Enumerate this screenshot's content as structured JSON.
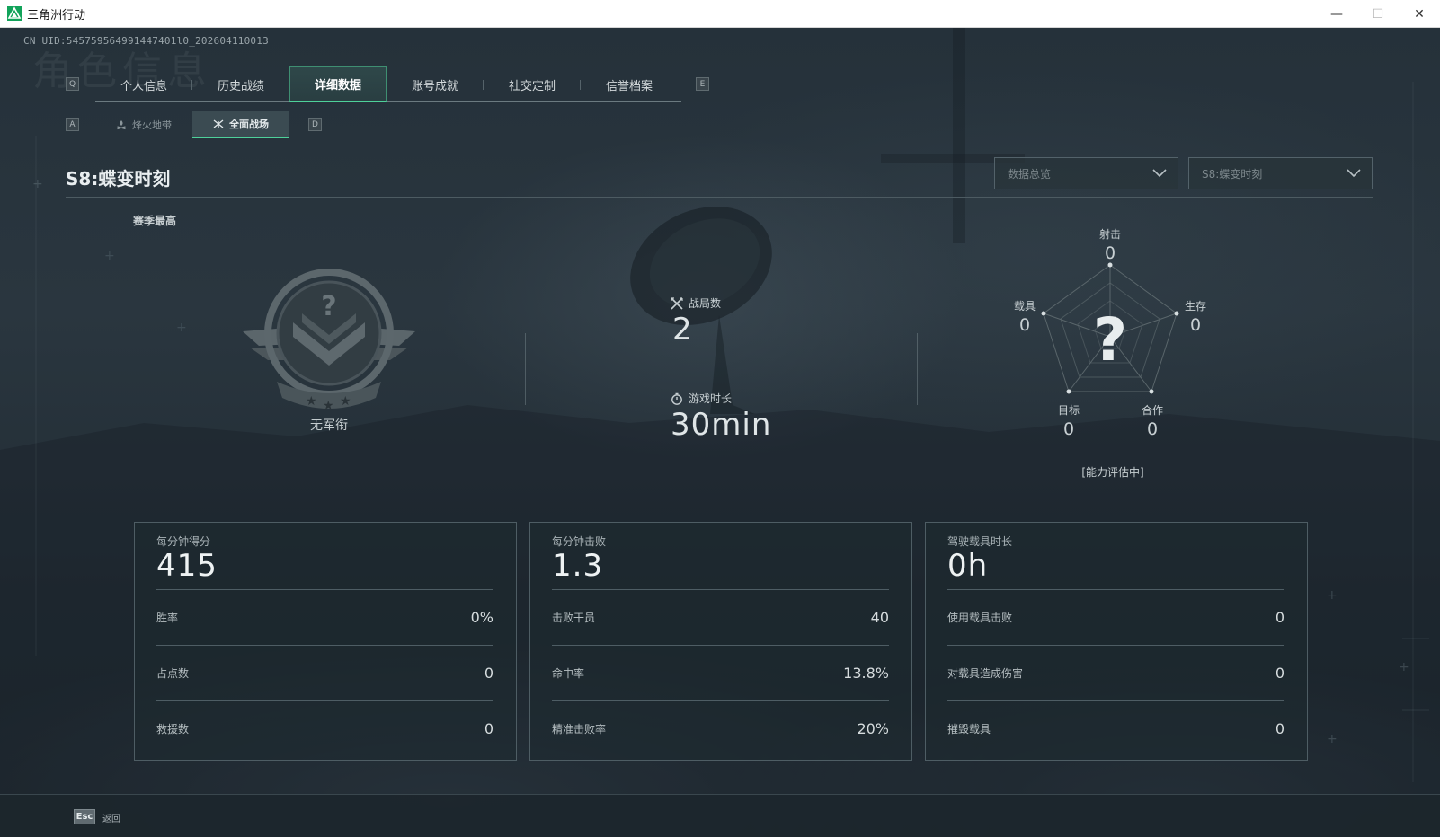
{
  "window": {
    "title": "三角洲行动",
    "minimize_glyph": "—",
    "maximize_glyph": "☐",
    "close_glyph": "✕"
  },
  "background": {
    "watermark": "角色信息"
  },
  "uid": "CN UID:545759564991447401l0_202604110013",
  "main_tabs": {
    "left_key": "Q",
    "right_key": "E",
    "items": [
      {
        "label": "个人信息",
        "active": false
      },
      {
        "label": "历史战绩",
        "active": false
      },
      {
        "label": "详细数据",
        "active": true
      },
      {
        "label": "账号成就",
        "active": false
      },
      {
        "label": "社交定制",
        "active": false
      },
      {
        "label": "信誉档案",
        "active": false
      }
    ]
  },
  "sub_tabs": {
    "left_key": "A",
    "right_key": "D",
    "items": [
      {
        "label": "烽火地带",
        "icon": "campfire-icon",
        "active": false
      },
      {
        "label": "全面战场",
        "icon": "crossed-rifles-icon",
        "active": true
      }
    ]
  },
  "season": {
    "title": "S8:蝶变时刻",
    "filter_select": "数据总览",
    "season_select": "S8:蝶变时刻"
  },
  "rank": {
    "section_label": "赛季最高",
    "name": "无军衔",
    "emblem_icon": "unknown-rank-emblem-icon"
  },
  "mid_stats": {
    "matches_label": "战局数",
    "matches_value": "2",
    "playtime_label": "游戏时长",
    "playtime_value": "30min"
  },
  "radar": {
    "center_glyph": "?",
    "status": "[能力评估中]",
    "axes": [
      {
        "label": "射击",
        "value": "0"
      },
      {
        "label": "生存",
        "value": "0"
      },
      {
        "label": "合作",
        "value": "0"
      },
      {
        "label": "目标",
        "value": "0"
      },
      {
        "label": "载具",
        "value": "0"
      }
    ]
  },
  "cards": [
    {
      "title": "每分钟得分",
      "main": "415",
      "rows": [
        {
          "label": "胜率",
          "value": "0%"
        },
        {
          "label": "占点数",
          "value": "0"
        },
        {
          "label": "救援数",
          "value": "0"
        }
      ]
    },
    {
      "title": "每分钟击败",
      "main": "1.3",
      "rows": [
        {
          "label": "击败干员",
          "value": "40"
        },
        {
          "label": "命中率",
          "value": "13.8%"
        },
        {
          "label": "精准击败率",
          "value": "20%"
        }
      ]
    },
    {
      "title": "驾驶载具时长",
      "main": "0h",
      "rows": [
        {
          "label": "使用载具击败",
          "value": "0"
        },
        {
          "label": "对载具造成伤害",
          "value": "0"
        },
        {
          "label": "摧毁载具",
          "value": "0"
        }
      ]
    }
  ],
  "footer": {
    "esc_key": "Esc",
    "back_label": "返回"
  },
  "colors": {
    "accent": "#4ed19a",
    "text": "#c8d0d3",
    "panel_border": "#4e5d64"
  }
}
